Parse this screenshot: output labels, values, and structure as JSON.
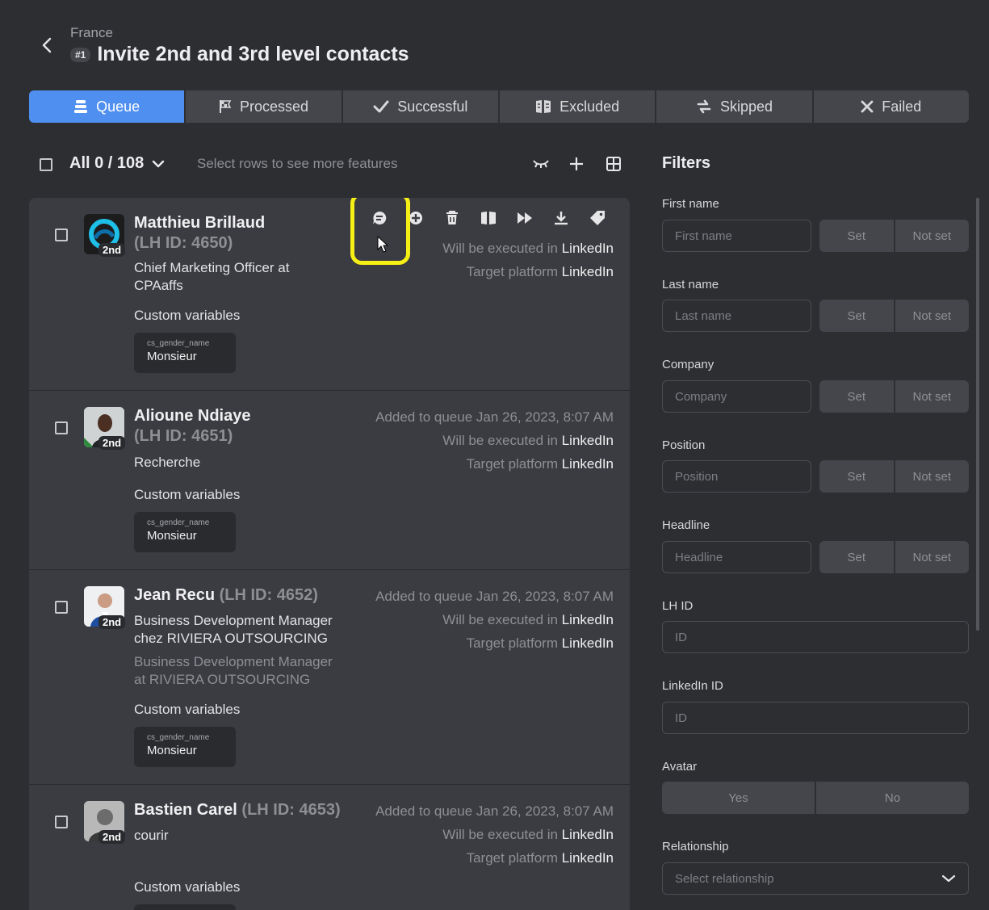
{
  "header": {
    "breadcrumb": "France",
    "badge": "#1",
    "title": "Invite 2nd and 3rd level contacts"
  },
  "tabs": [
    {
      "label": "Queue",
      "icon": "queue-icon",
      "active": true
    },
    {
      "label": "Processed",
      "icon": "flag-icon"
    },
    {
      "label": "Successful",
      "icon": "check-icon"
    },
    {
      "label": "Excluded",
      "icon": "excluded-icon"
    },
    {
      "label": "Skipped",
      "icon": "skip-icon"
    },
    {
      "label": "Failed",
      "icon": "x-icon"
    }
  ],
  "toolbar": {
    "all_count": "All 0 / 108",
    "hint": "Select rows to see more features"
  },
  "row_actions": [
    "message-icon",
    "add-icon",
    "delete-icon",
    "exclude-icon",
    "skip-icon",
    "download-icon",
    "tag-icon"
  ],
  "rows": [
    {
      "name": "Matthieu Brillaud",
      "lhid": "(LH ID: 4650)",
      "degree": "2nd",
      "headline_lines": [
        "Chief Marketing Officer at",
        "CPAaffs"
      ],
      "position_lines": [],
      "custom_label": "Custom variables",
      "cv_key": "cs_gender_name",
      "cv_value": "Monsieur",
      "added": "",
      "exec_prefix": "Will be executed in",
      "exec_platform": "LinkedIn",
      "target_prefix": "Target platform",
      "target_platform": "LinkedIn"
    },
    {
      "name": "Alioune Ndiaye",
      "lhid": "(LH ID: 4651)",
      "degree": "2nd",
      "headline_lines": [
        "Recherche"
      ],
      "position_lines": [],
      "custom_label": "Custom variables",
      "cv_key": "cs_gender_name",
      "cv_value": "Monsieur",
      "added": "Added to queue Jan 26, 2023, 8:07 AM",
      "exec_prefix": "Will be executed in",
      "exec_platform": "LinkedIn",
      "target_prefix": "Target platform",
      "target_platform": "LinkedIn"
    },
    {
      "name": "Jean Recu",
      "lhid": "(LH ID: 4652)",
      "degree": "2nd",
      "headline_lines": [
        "Business Development Manager",
        "chez RIVIERA OUTSOURCING"
      ],
      "position_lines": [
        "Business Development Manager",
        "at RIVIERA OUTSOURCING"
      ],
      "custom_label": "Custom variables",
      "cv_key": "cs_gender_name",
      "cv_value": "Monsieur",
      "added": "Added to queue Jan 26, 2023, 8:07 AM",
      "exec_prefix": "Will be executed in",
      "exec_platform": "LinkedIn",
      "target_prefix": "Target platform",
      "target_platform": "LinkedIn"
    },
    {
      "name": "Bastien Carel",
      "lhid": "(LH ID: 4653)",
      "degree": "2nd",
      "headline_lines": [
        "courir"
      ],
      "position_lines": [],
      "custom_label": "Custom variables",
      "cv_key": "",
      "cv_value": "",
      "added": "Added to queue Jan 26, 2023, 8:07 AM",
      "exec_prefix": "Will be executed in",
      "exec_platform": "LinkedIn",
      "target_prefix": "Target platform",
      "target_platform": "LinkedIn"
    }
  ],
  "filters": {
    "title": "Filters",
    "first_name": {
      "label": "First name",
      "placeholder": "First name"
    },
    "last_name": {
      "label": "Last name",
      "placeholder": "Last name"
    },
    "company": {
      "label": "Company",
      "placeholder": "Company"
    },
    "position": {
      "label": "Position",
      "placeholder": "Position"
    },
    "headline": {
      "label": "Headline",
      "placeholder": "Headline"
    },
    "set_label": "Set",
    "not_set_label": "Not set",
    "lh_id": {
      "label": "LH ID",
      "placeholder": "ID"
    },
    "linkedin_id": {
      "label": "LinkedIn ID",
      "placeholder": "ID"
    },
    "avatar": {
      "label": "Avatar",
      "yes": "Yes",
      "no": "No"
    },
    "relationship": {
      "label": "Relationship",
      "placeholder": "Select relationship"
    }
  },
  "colors": {
    "accent": "#4f8ff0",
    "highlight": "#f6ef16",
    "background": "#2d2e32",
    "panel": "#3b3c41"
  }
}
